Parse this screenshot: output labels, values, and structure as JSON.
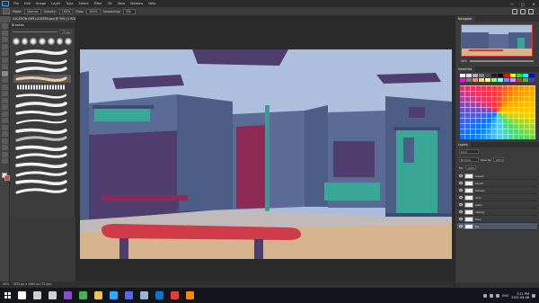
{
  "menubar": {
    "logo": "Ps",
    "items": [
      "File",
      "Edit",
      "Image",
      "Layer",
      "Type",
      "Select",
      "Filter",
      "3D",
      "View",
      "Window",
      "Help"
    ],
    "window_controls": [
      "—",
      "□",
      "✕"
    ]
  },
  "options_bar": {
    "mode_label": "Mode:",
    "mode_value": "Normal",
    "opacity_label": "Opacity:",
    "opacity_value": "100%",
    "flow_label": "Flow:",
    "flow_value": "100%",
    "smoothing_label": "Smoothing:",
    "smoothing_value": "0%"
  },
  "document_tab": {
    "title": "LOCATION GYM LOCKERS.psd @ 50% (1 RGB/8*)"
  },
  "brush_panel": {
    "title": "Brushes",
    "size_value": "23 px"
  },
  "status_bar": {
    "zoom": "50%",
    "doc_info": "1920 px x 1080 px (72 ppi)"
  },
  "navigator": {
    "tabs": [
      "Navigator"
    ],
    "zoom": "50%"
  },
  "swatches": {
    "tabs": [
      "Swatches"
    ],
    "colors": [
      "#ffffff",
      "#e0e0e0",
      "#b0b0b0",
      "#808080",
      "#505050",
      "#202020",
      "#000000",
      "#ff0000",
      "#ffff00",
      "#00ff00",
      "#00ffff",
      "#0000ff",
      "#ff00ff",
      "#7f7f7f",
      "#ff8080",
      "#ffcc80",
      "#ffff80",
      "#80ff80",
      "#80ffff",
      "#8080ff",
      "#ff80ff",
      "#c04040",
      "#40c040",
      "#4040c0"
    ]
  },
  "layers": {
    "tabs": [
      "Layers"
    ],
    "kind_label": "Kind",
    "blend_mode": "Normal",
    "opacity_label": "Opacity:",
    "opacity_value": "100%",
    "fill_label": "Fill:",
    "fill_value": "100%",
    "items": [
      "lineart",
      "bench",
      "lockers",
      "door",
      "walls",
      "ceiling",
      "floor",
      "bg"
    ]
  },
  "taskbar": {
    "icons": [
      {
        "name": "search-icon",
        "color": "#ffffff"
      },
      {
        "name": "task-view-icon",
        "color": "#cfcfcf"
      },
      {
        "name": "obs-icon",
        "color": "#d0d0d0"
      },
      {
        "name": "app-purple-icon",
        "color": "#8a4bd8"
      },
      {
        "name": "chrome-icon",
        "color": "#4caf50"
      },
      {
        "name": "file-explorer-icon",
        "color": "#f2c14e"
      },
      {
        "name": "photoshop-icon",
        "color": "#31a8ff"
      },
      {
        "name": "discord-icon",
        "color": "#5865f2"
      },
      {
        "name": "steam-icon",
        "color": "#9fb4cc"
      },
      {
        "name": "mail-icon",
        "color": "#0078d4"
      },
      {
        "name": "app-red-icon",
        "color": "#e0403b"
      },
      {
        "name": "vlc-icon",
        "color": "#ff8800"
      }
    ],
    "lang": "ENG",
    "time": "2:11 PM",
    "date": "2021-04-08"
  },
  "colors": {
    "canvas_sky": "#a9bcdb",
    "wall_dark": "#4c5d86",
    "floor": "#d5b48e",
    "bench": "#cf3b48",
    "locker": "#4f3d6e",
    "door": "#3aa796",
    "accent_red": "#8e2b55",
    "teal_pipe": "#3a9c8e"
  }
}
